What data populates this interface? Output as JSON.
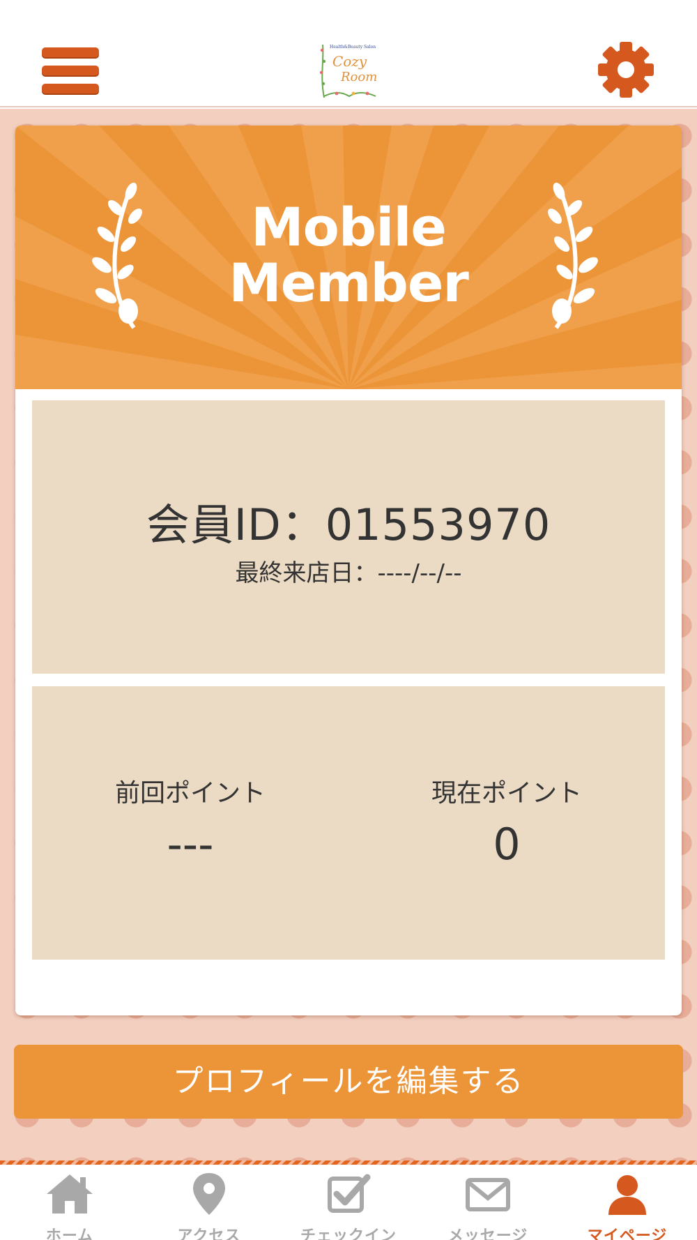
{
  "header": {
    "logo": {
      "top_text": "Health&Beauty Salon",
      "name_line1": "Cozy",
      "name_line2": "Room"
    },
    "menu_icon": "hamburger-menu-icon",
    "settings_icon": "gear-icon"
  },
  "banner": {
    "title_line1": "Mobile",
    "title_line2": "Member"
  },
  "member": {
    "id_text": "会員ID：01553970",
    "last_visit_text": "最終来店日：----/--/--"
  },
  "points": {
    "previous_label": "前回ポイント",
    "previous_value": "---",
    "current_label": "現在ポイント",
    "current_value": "0"
  },
  "edit_profile_label": "プロフィールを編集する",
  "tabs": [
    {
      "label": "ホーム",
      "icon": "home-icon",
      "active": false
    },
    {
      "label": "アクセス",
      "icon": "map-pin-icon",
      "active": false
    },
    {
      "label": "チェックイン",
      "icon": "checkbox-icon",
      "active": false
    },
    {
      "label": "メッセージ",
      "icon": "envelope-icon",
      "active": false
    },
    {
      "label": "マイページ",
      "icon": "user-icon",
      "active": true
    }
  ],
  "colors": {
    "accent": "#d5591f",
    "orange": "#ec9438",
    "panel": "#ecdbc4",
    "background": "#f3cfc0"
  }
}
